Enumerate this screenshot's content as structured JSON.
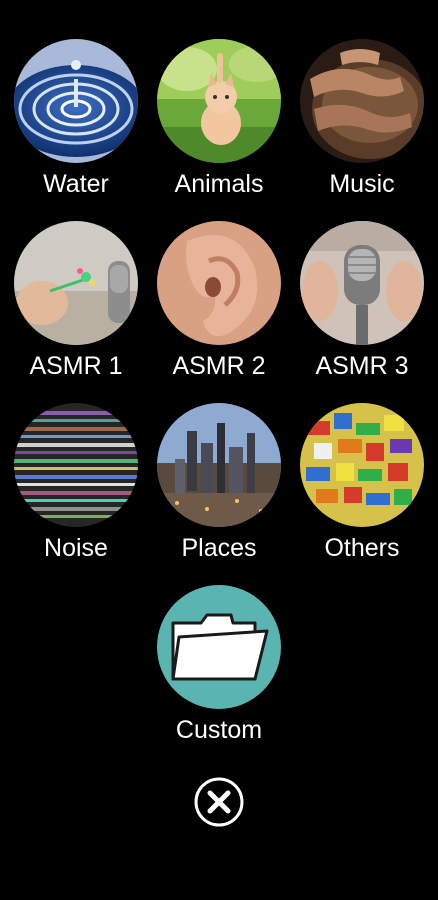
{
  "categories": [
    {
      "label": "Water",
      "icon": "water-drop-icon"
    },
    {
      "label": "Animals",
      "icon": "kitten-icon"
    },
    {
      "label": "Music",
      "icon": "drum-hands-icon"
    },
    {
      "label": "ASMR 1",
      "icon": "asmr-microphone-hand-icon"
    },
    {
      "label": "ASMR 2",
      "icon": "ear-icon"
    },
    {
      "label": "ASMR 3",
      "icon": "asmr-microphone-icon"
    },
    {
      "label": "Noise",
      "icon": "static-noise-icon"
    },
    {
      "label": "Places",
      "icon": "city-skyline-icon"
    },
    {
      "label": "Others",
      "icon": "toy-bricks-icon"
    }
  ],
  "custom": {
    "label": "Custom",
    "icon": "folder-icon"
  },
  "close": {
    "icon": "close-icon"
  },
  "colors": {
    "background": "#000000",
    "custom_circle": "#5ab5b0",
    "text": "#ffffff"
  }
}
